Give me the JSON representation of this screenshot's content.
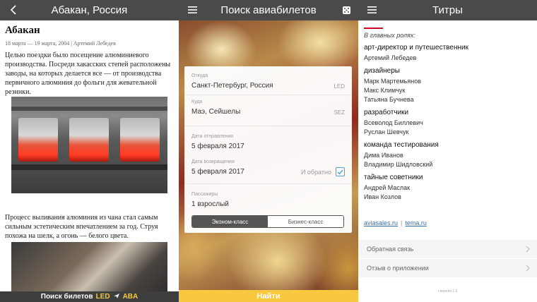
{
  "panel1": {
    "header_title": "Абакан, Россия",
    "article": {
      "title": "Абакан",
      "meta": "18 марта — 19 марта, 2004 | Артемий Лебедев",
      "paragraph1": "Целью поездки было посещение алюминиевого производства. Посреди хакасских степей расположены заводы, на которых делается все — от производства первичного алюминия до фольги для жевательной резинки.",
      "paragraph2": "Процесс выливания алюминия из чана стал самым сильным эстетическим впечатлением за год. Струя похожа на шелк, а огонь — белого цвета."
    },
    "bottom_bar": {
      "label": "Поиск билетов",
      "from_code": "LED",
      "to_code": "ABA"
    }
  },
  "panel2": {
    "header_title": "Поиск авиабилетов",
    "from": {
      "label": "Откуда",
      "value": "Санкт-Петербург, Россия",
      "code": "LED"
    },
    "to": {
      "label": "Куда",
      "value": "Маэ, Сейшелы",
      "code": "SEZ"
    },
    "depart": {
      "label": "Дата отправления",
      "value": "5 февраля 2017"
    },
    "return": {
      "label": "Дата возвращения",
      "value": "5 февраля 2017",
      "toggle_label": "И обратно",
      "checked": true
    },
    "passengers": {
      "label": "Пассажиры",
      "value": "1 взрослый"
    },
    "class_options": [
      "Эконом-класс",
      "Бизнес-класс"
    ],
    "selected_class": "Эконом-класс",
    "find_button": "Найти"
  },
  "panel3": {
    "header_title": "Титры",
    "intro": "В главных ролях:",
    "sections": [
      {
        "heading": "арт-директор и путешественник",
        "names": [
          "Артемий Лебедев"
        ]
      },
      {
        "heading": "дизайнеры",
        "names": [
          "Марк Мартемьянов",
          "Макс Климчук",
          "Татьяна Бучнева"
        ]
      },
      {
        "heading": "разработчики",
        "names": [
          "Всеволод Биллевич",
          "Руслан Шевчук"
        ]
      },
      {
        "heading": "команда тестирования",
        "names": [
          "Дима Иванов",
          "Владимир Шидловский"
        ]
      },
      {
        "heading": "тайные советники",
        "names": [
          "Андрей Маслак",
          "Иван Козлов"
        ]
      }
    ],
    "links": [
      "aviasales.ru",
      "tema.ru"
    ],
    "link_separator": "|",
    "menu": [
      "Обратная связь",
      "Отзыв о приложении"
    ],
    "version": "• версия 1.0"
  },
  "colors": {
    "header_bg": "#4a4a4a",
    "accent_red": "#d0021b",
    "find_yellow": "#f8c93e",
    "link_blue": "#3a6fb0",
    "checkbox_blue": "#4aa3d8"
  },
  "icons": {
    "panel1_left": "back-chevron-icon",
    "panel2_left": "menu-icon",
    "panel2_right": "dice-icon",
    "panel3_left": "menu-icon",
    "menu_chevron": "chevron-right-icon",
    "swap_arrow": "plane-icon"
  }
}
